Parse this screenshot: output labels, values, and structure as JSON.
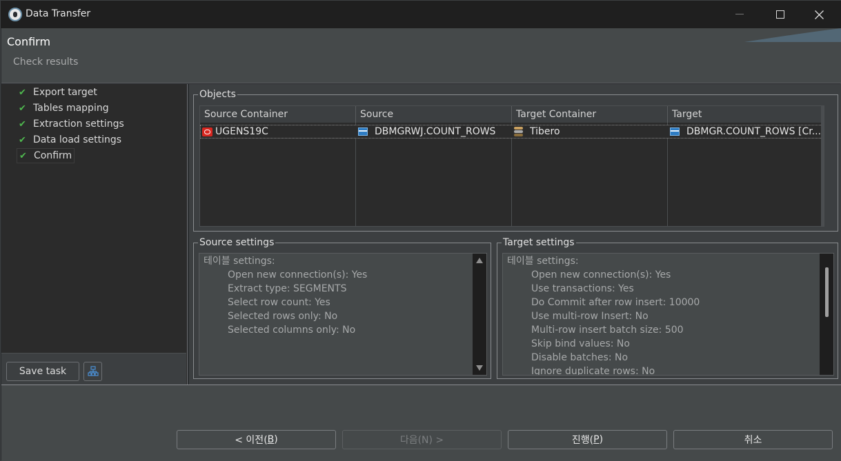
{
  "window": {
    "title": "Data Transfer",
    "minimize_icon": "minimize-icon",
    "maximize_icon": "maximize-icon",
    "close_icon": "close-icon"
  },
  "header": {
    "title": "Confirm",
    "subtitle": "Check results"
  },
  "steps": [
    {
      "label": "Export target",
      "done": true
    },
    {
      "label": "Tables mapping",
      "done": true
    },
    {
      "label": "Extraction settings",
      "done": true
    },
    {
      "label": "Data load settings",
      "done": true
    },
    {
      "label": "Confirm",
      "done": true,
      "active": true
    }
  ],
  "left_actions": {
    "save_task": "Save task",
    "tree_icon": "task-tree-icon"
  },
  "objects": {
    "group_label": "Objects",
    "columns": [
      "Source Container",
      "Source",
      "Target Container",
      "Target"
    ],
    "rows": [
      {
        "source_container": "UGENS19C",
        "source": "DBMGRWJ.COUNT_ROWS",
        "target_container": "Tibero",
        "target": "DBMGR.COUNT_ROWS [Cr..."
      }
    ]
  },
  "source_settings": {
    "group_label": "Source settings",
    "heading": "테이블 settings:",
    "lines": [
      "Open new connection(s): Yes",
      "Extract type: SEGMENTS",
      "Select row count: Yes",
      "Selected rows only: No",
      "Selected columns only: No"
    ]
  },
  "target_settings": {
    "group_label": "Target settings",
    "heading": "테이블 settings:",
    "lines": [
      "Open new connection(s): Yes",
      "Use transactions: Yes",
      "Do Commit after row insert: 10000",
      "Use multi-row Insert: No",
      "Multi-row insert batch size: 500",
      "Skip bind values: No",
      "Disable batches: No",
      "Ignore duplicate rows: No"
    ]
  },
  "buttons": {
    "back": "< 이전(",
    "back_key": "B",
    "back_end": ")",
    "next": "다음(N) >",
    "proceed": "진행(",
    "proceed_key": "P",
    "proceed_end": ")",
    "cancel": "취소"
  },
  "colors": {
    "check": "#4fb84f",
    "background": "#3c3f41",
    "panel": "#2b2b2b"
  }
}
